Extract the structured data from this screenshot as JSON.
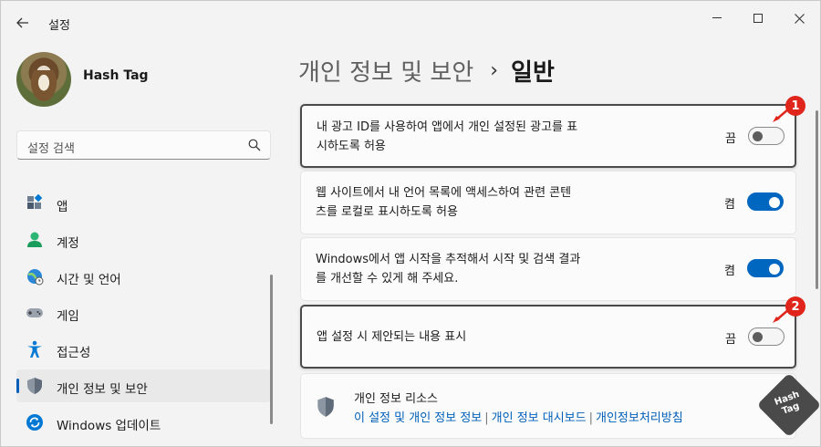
{
  "window": {
    "title": "설정"
  },
  "profile": {
    "name": "Hash Tag"
  },
  "search": {
    "placeholder": "설정 검색"
  },
  "nav": {
    "items": [
      {
        "label": "앱",
        "icon": "apps-icon"
      },
      {
        "label": "계정",
        "icon": "account-icon"
      },
      {
        "label": "시간 및 언어",
        "icon": "time-language-icon"
      },
      {
        "label": "게임",
        "icon": "gaming-icon"
      },
      {
        "label": "접근성",
        "icon": "accessibility-icon"
      },
      {
        "label": "개인 정보 및 보안",
        "icon": "shield-icon",
        "active": true
      },
      {
        "label": "Windows 업데이트",
        "icon": "update-icon"
      }
    ]
  },
  "header": {
    "parent": "개인 정보 및 보안",
    "separator": "›",
    "current": "일반"
  },
  "settings": [
    {
      "line1": "내 광고 ID를 사용하여 앱에서 개인 설정된 광고를 표",
      "line2": "시하도록 허용",
      "state": "끔",
      "on": false,
      "badge": "1"
    },
    {
      "line1": "웹 사이트에서 내 언어 목록에 액세스하여 관련 콘텐",
      "line2": "츠를 로컬로 표시하도록 허용",
      "state": "켬",
      "on": true
    },
    {
      "line1": "Windows에서 앱 시작을 추적해서 시작 및 검색 결과",
      "line2": "를 개선할 수 있게 해 주세요.",
      "state": "켬",
      "on": true
    },
    {
      "line1": "앱 설정 시 제안되는 내용 표시",
      "state": "끔",
      "on": false,
      "badge": "2"
    }
  ],
  "resources": {
    "title": "개인 정보 리소스",
    "links": [
      "이 설정 및 개인 정보 정보",
      "개인 정보 대시보드",
      "개인정보처리방침"
    ]
  },
  "watermark": {
    "line1": "Hash",
    "line2": "Tag"
  },
  "colors": {
    "accent": "#0067c0",
    "badge": "#e0261c"
  }
}
